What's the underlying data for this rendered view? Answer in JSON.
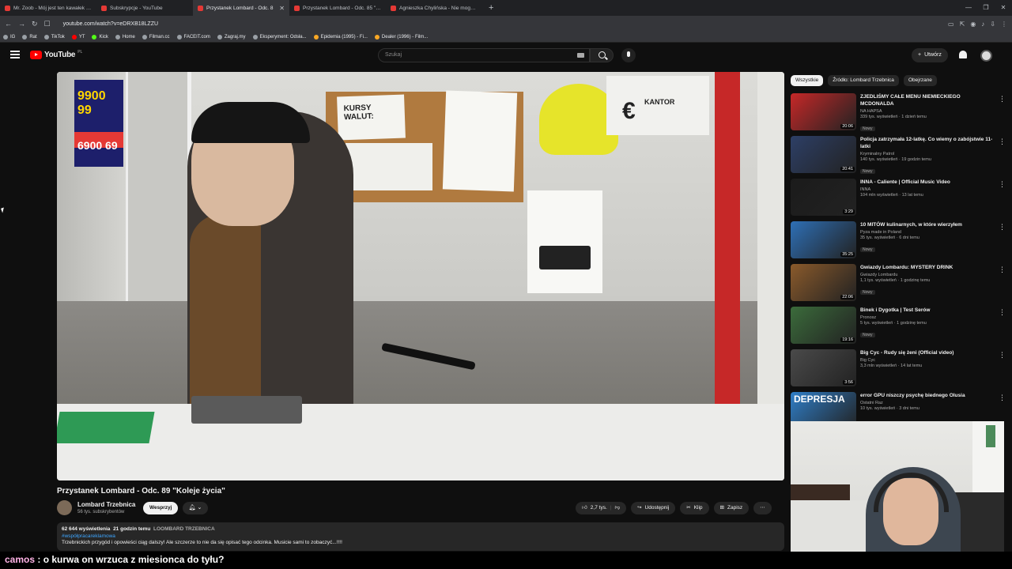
{
  "browser": {
    "tabs": [
      {
        "label": "Mr. Zoob - Mój jest ten kawałek pod",
        "active": false
      },
      {
        "label": "Subskrypcje - YouTube",
        "active": false
      },
      {
        "label": "Przystanek Lombard - Odc. 8",
        "active": true
      },
      {
        "label": "Przystanek Lombard - Odc. 85 \"Vla W",
        "active": false
      },
      {
        "label": "Agnieszka Chylińska - Nie mogę Cię",
        "active": false
      }
    ],
    "url": "youtube.com/watch?v=eDRXB18LZZU",
    "bookmarks": [
      "IG",
      "Rat",
      "TikTok",
      "YT",
      "Kick",
      "Home",
      "Filman.cc",
      "FACEIT.com",
      "Zagraj.my",
      "Eksperyment: Odsła...",
      "Epidemia (1995) - Fi...",
      "Dealer (1996) - Film..."
    ]
  },
  "header": {
    "logo": "YouTube",
    "country": "PL",
    "search_placeholder": "Szukaj",
    "create_label": "Utwórz"
  },
  "video": {
    "title": "Przystanek Lombard - Odc. 89 \"Koleje życia\"",
    "channel": "Lombard Trzebnica",
    "subscribers": "56 tys. subskrybentów",
    "support_label": "Wesprzyj",
    "likes": "2,7 tys.",
    "share_label": "Udostępnij",
    "clip_label": "Klip",
    "save_label": "Zapisz",
    "poster_price1": "9900 99",
    "poster_price2": "6900 69",
    "notice_text": "KURSY WALUT:",
    "kantor_label": "KANTOR"
  },
  "description": {
    "views": "62 644 wyświetlenia",
    "time": "21 godzin temu",
    "channel_caps": "LOOMBARD TRZEBNICA",
    "hashtag": "#współpracareklamowa",
    "text": "Trzebnickich przygód i opowieści ciąg dalszy! Ale szczerze to nie da się opisać tego odcinka. Musicie sami to zobaczyć...!!!!"
  },
  "chips": [
    "Wszystkie",
    "Źródło: Lombard Trzebnica",
    "Obejrzane"
  ],
  "recommendations": [
    {
      "title": "ZJEDLIŚMY CAŁE MENU NIEMIECKIEGO MCDONALDA",
      "channel": "NA HAPSA",
      "stats": "339 tys. wyświetleń · 1 dzień temu",
      "badge": "Nowy",
      "duration": "20:06",
      "color": "#c62828"
    },
    {
      "title": "Policja zatrzymała 12-latkę. Co wiemy o zabójstwie 11-latki",
      "channel": "Kryminalny Patrol",
      "stats": "140 tys. wyświetleń · 19 godzin temu",
      "badge": "Nowy",
      "duration": "20:41",
      "color": "#2d3f66"
    },
    {
      "title": "INNA - Caliente | Official Music Video",
      "channel": "INNA",
      "stats": "104 mln wyświetleń · 13 lat temu",
      "badge": "",
      "duration": "3:29",
      "color": "#1b1b1b"
    },
    {
      "title": "10 MITÓW kulinarnych, w które wierzyłem",
      "channel": "Pyza made in Poland",
      "stats": "35 tys. wyświetleń · 6 dni temu",
      "badge": "Nowy",
      "duration": "35:25",
      "color": "#2e6fb5"
    },
    {
      "title": "Gwiazdy Lombardu: MYSTERY DRINK",
      "channel": "Gwiazdy Lombardu",
      "stats": "1,1 tys. wyświetleń · 1 godzinę temu",
      "badge": "Nowy",
      "duration": "22:06",
      "color": "#8a5a2b"
    },
    {
      "title": "Binek i Dygotka | Test Serów",
      "channel": "Pronosz",
      "stats": "5 tys. wyświetleń · 1 godzinę temu",
      "badge": "Nowy",
      "duration": "19:16",
      "color": "#3b6b3b"
    },
    {
      "title": "Big Cyc - Rudy się żeni (Official video)",
      "channel": "Big Cyc",
      "stats": "3,3 mln wyświetleń · 14 lat temu",
      "badge": "",
      "duration": "3:56",
      "color": "#4a4a4a"
    },
    {
      "title": "error GPU niszczy psychę biednego Olusia",
      "channel": "Ostatni Raz",
      "stats": "10 tys. wyświetleń · 3 dni temu",
      "badge": "",
      "duration": "",
      "color": "#2f7ec7",
      "thumb_text": "DEPRESJA"
    }
  ],
  "chat": {
    "user": "camos",
    "message": " : o kurwa on wrzuca z miesionca do tyłu?"
  }
}
